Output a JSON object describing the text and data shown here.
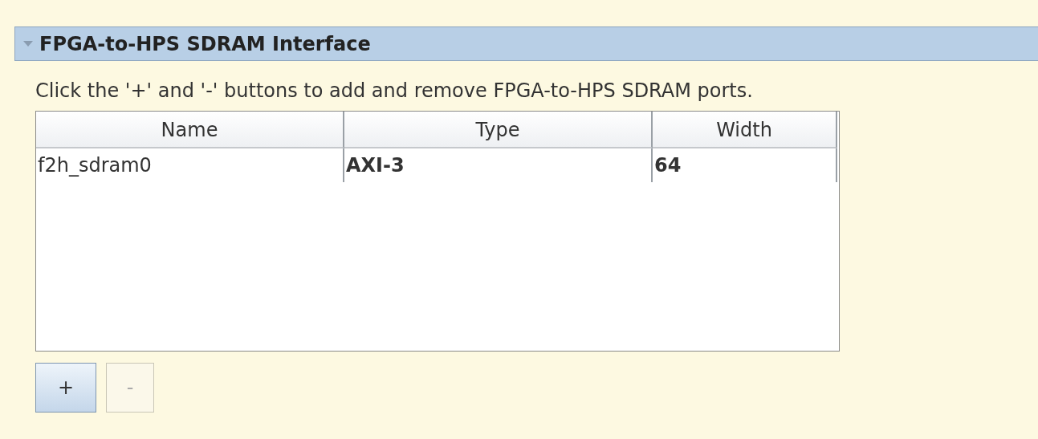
{
  "section": {
    "title": "FPGA-to-HPS SDRAM Interface",
    "expanded": true
  },
  "description": "Click the '+' and '-' buttons to add and remove FPGA-to-HPS SDRAM ports.",
  "table": {
    "columns": [
      {
        "label": "Name",
        "bold": false
      },
      {
        "label": "Type",
        "bold": true
      },
      {
        "label": "Width",
        "bold": true
      }
    ],
    "rows": [
      {
        "cells": [
          "f2h_sdram0",
          "AXI-3",
          "64"
        ]
      }
    ]
  },
  "buttons": [
    {
      "label": "+",
      "disabled": false
    },
    {
      "label": "-",
      "disabled": true
    }
  ]
}
